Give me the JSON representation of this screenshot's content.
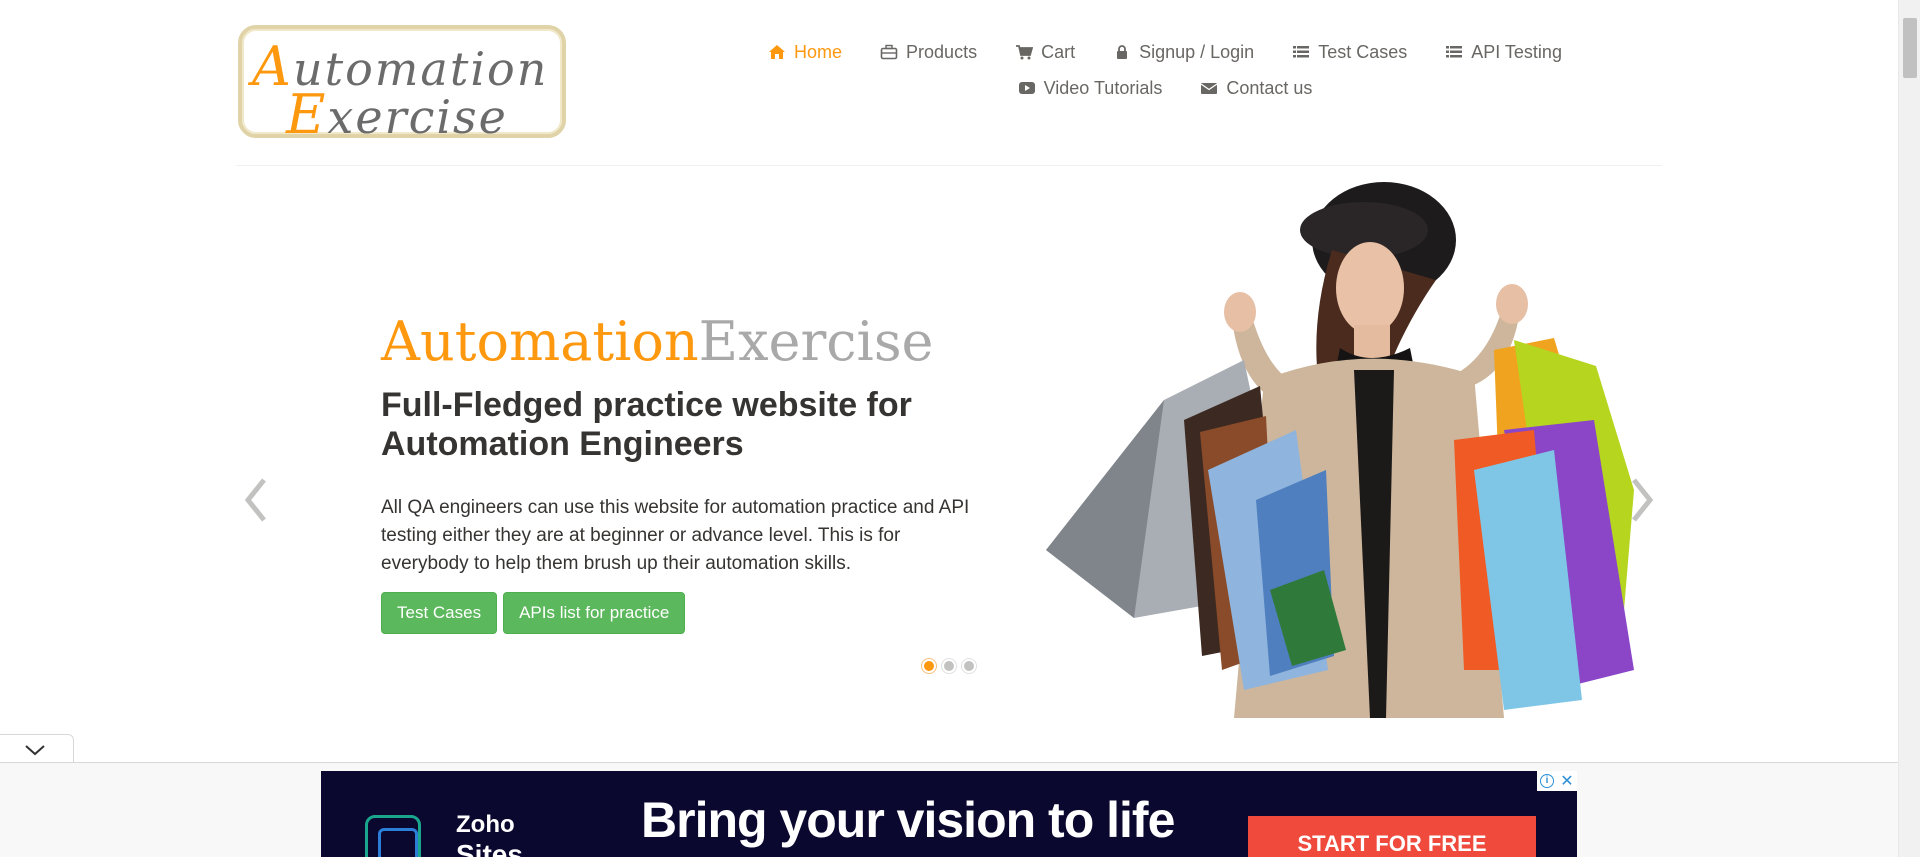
{
  "logo": {
    "line1_cap": "A",
    "line1_rest": "utomation",
    "line2_cap": "E",
    "line2_rest": "xercise"
  },
  "nav": {
    "items": [
      {
        "label": "Home",
        "icon": "home-icon"
      },
      {
        "label": "Products",
        "icon": "briefcase-icon"
      },
      {
        "label": "Cart",
        "icon": "cart-icon"
      },
      {
        "label": "Signup / Login",
        "icon": "lock-icon"
      },
      {
        "label": "Test Cases",
        "icon": "list-icon"
      },
      {
        "label": "API Testing",
        "icon": "list-icon"
      },
      {
        "label": "Video Tutorials",
        "icon": "youtube-icon"
      },
      {
        "label": "Contact us",
        "icon": "envelope-icon"
      }
    ]
  },
  "slider": {
    "brand_part1": "Automation",
    "brand_part2": "Exercise",
    "headline": "Full-Fledged practice website for Automation Engineers",
    "description": "All QA engineers can use this website for automation practice and API testing either they are at beginner or advance level. This is for everybody to help them brush up their automation skills.",
    "buttons": {
      "test_cases": "Test Cases",
      "apis_list": "APIs list for practice"
    },
    "active_slide": 1,
    "slide_count": 3
  },
  "ad": {
    "brand_line1": "Zoho",
    "brand_line2": "Sites",
    "headline": "Bring your vision to life",
    "cta": "START FOR FREE",
    "info_symbol": "i",
    "close_symbol": "✕"
  },
  "colors": {
    "accent": "#fe980f",
    "button_green": "#5cb85c",
    "text_dark": "#363432",
    "ad_bg": "#0b0830",
    "ad_cta": "#f04a3c"
  }
}
